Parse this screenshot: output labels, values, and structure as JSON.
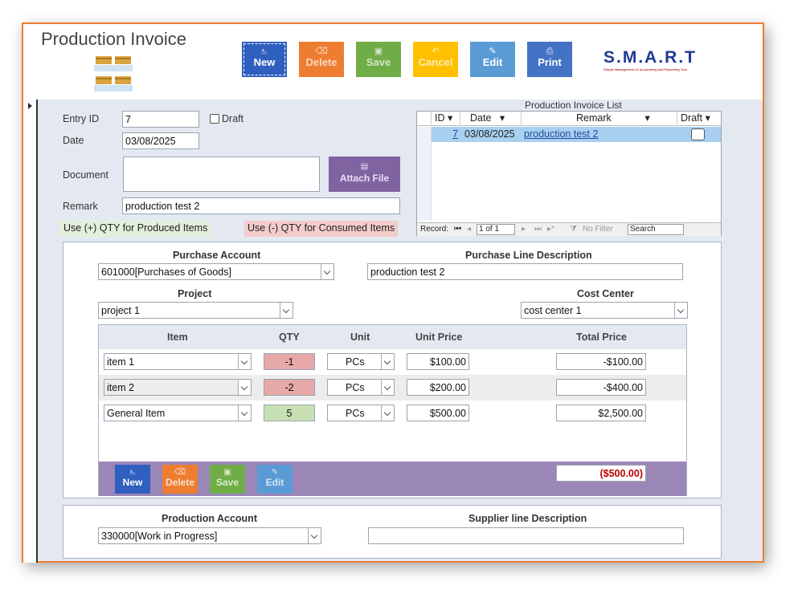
{
  "header": {
    "title": "Production Invoice",
    "brand": "S.M.A.R.T",
    "brand_sub": "Simple Management of Accounting and Reporting Tool"
  },
  "toolbar": [
    {
      "label": "New",
      "icon": "new-icon",
      "color": "#2f5fbf"
    },
    {
      "label": "Delete",
      "icon": "eraser-icon",
      "color": "#ed7d31"
    },
    {
      "label": "Save",
      "icon": "save-icon",
      "color": "#70ad47"
    },
    {
      "label": "Cancel",
      "icon": "undo-icon",
      "color": "#ffc000"
    },
    {
      "label": "Edit",
      "icon": "edit-icon",
      "color": "#5b9bd5"
    },
    {
      "label": "Print",
      "icon": "print-icon",
      "color": "#4472c4"
    }
  ],
  "form": {
    "entry_id_label": "Entry ID",
    "entry_id": "7",
    "draft_label": "Draft",
    "date_label": "Date",
    "date": "03/08/2025",
    "document_label": "Document",
    "attach_label": "Attach File",
    "remark_label": "Remark",
    "remark": "production test 2",
    "hint_produced": "Use (+) QTY for Produced Items",
    "hint_consumed": "Use (-) QTY for Consumed Items"
  },
  "list": {
    "title": "Production Invoice List",
    "columns": [
      "ID",
      "Date",
      "Remark",
      "Draft"
    ],
    "rows": [
      {
        "id": "7",
        "date": "03/08/2025",
        "remark": "production test 2",
        "draft": false
      }
    ],
    "nav": {
      "record_label": "Record:",
      "position": "1 of 1",
      "filter": "No Filter",
      "search": "Search"
    }
  },
  "purchase": {
    "account_label": "Purchase Account",
    "account": "601000[Purchases of Goods]",
    "line_desc_label": "Purchase Line Description",
    "line_desc": "production test 2",
    "project_label": "Project",
    "project": "project 1",
    "cost_center_label": "Cost Center",
    "cost_center": "cost center 1"
  },
  "lines": {
    "columns": [
      "Item",
      "QTY",
      "Unit",
      "Unit Price",
      "Total Price"
    ],
    "rows": [
      {
        "item": "item 1",
        "qty": "-1",
        "unit": "PCs",
        "unit_price": "$100.00",
        "total": "-$100.00",
        "qty_color": "#e6a8a8"
      },
      {
        "item": "item 2",
        "qty": "-2",
        "unit": "PCs",
        "unit_price": "$200.00",
        "total": "-$400.00",
        "qty_color": "#e6a8a8"
      },
      {
        "item": "General Item",
        "qty": "5",
        "unit": "PCs",
        "unit_price": "$500.00",
        "total": "$2,500.00",
        "qty_color": "#c6e0b4"
      }
    ],
    "buttons": [
      {
        "label": "New",
        "icon": "new-icon",
        "color": "#2f5fbf"
      },
      {
        "label": "Delete",
        "icon": "eraser-icon",
        "color": "#ed7d31"
      },
      {
        "label": "Save",
        "icon": "save-icon",
        "color": "#70ad47"
      },
      {
        "label": "Edit",
        "icon": "edit-icon",
        "color": "#5b9bd5"
      }
    ],
    "grand_total": "($500.00)"
  },
  "production": {
    "account_label": "Production Account",
    "account": "330000[Work in Progress]",
    "supplier_desc_label": "Supplier line Description",
    "supplier_desc": ""
  }
}
